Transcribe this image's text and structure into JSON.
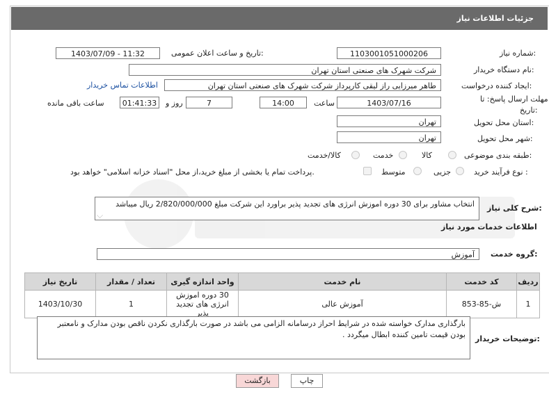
{
  "header": {
    "title": "جزئیات اطلاعات نیاز"
  },
  "fields": {
    "need_number_label": "شماره نیاز:",
    "need_number_value": "1103001051000206",
    "announce_label": "تاریخ و ساعت اعلان عمومی:",
    "announce_value": "1403/07/09 - 11:32",
    "buyer_org_label": "نام دستگاه خریدار:",
    "buyer_org_value": "شرکت شهرک های صنعتی استان تهران",
    "creator_label": "ایجاد کننده درخواست:",
    "creator_value": "طاهر  میرزایی راز لیقی کارپرداز شرکت شهرک های صنعتی استان تهران",
    "contact_link": "اطلاعات تماس خریدار",
    "deadline_label_1": "مهلت ارسال پاسخ: تا",
    "deadline_label_2": "تاریخ:",
    "deadline_date": "1403/07/16",
    "time_label": "ساعت",
    "deadline_time": "14:00",
    "days_value": "7",
    "days_label": "روز و",
    "remaining_value": "01:41:33",
    "remaining_label": "ساعت باقی مانده",
    "province_label": "استان محل تحویل:",
    "province_value": "تهران",
    "city_label": "شهر محل تحویل:",
    "city_value": "تهران",
    "category_label": "طبقه بندی موضوعی:",
    "category_options": [
      "کالا",
      "خدمت",
      "کالا/خدمت"
    ],
    "process_label": "نوع فرآیند خرید :",
    "process_options": [
      "جزیی",
      "متوسط"
    ],
    "payment_text": "پرداخت تمام یا بخشی از مبلغ خرید،از محل \"اسناد خزانه اسلامی\" خواهد بود."
  },
  "description": {
    "label": "شرح کلی نیاز:",
    "value": "انتخاب مشاور برای 30 دوره اموزش انرژی های تجدید پذیر براورد این شرکت مبلغ 2/820/000/000 ریال میباشد"
  },
  "services": {
    "section_title": "اطلاعات خدمات مورد نیاز",
    "group_label": "گروه خدمت:",
    "group_value": "آموزش",
    "columns": [
      "ردیف",
      "کد خدمت",
      "نام خدمت",
      "واحد اندازه گیری",
      "تعداد / مقدار",
      "تاریخ نیاز"
    ],
    "rows": [
      {
        "row": "1",
        "code": "ش-85-853",
        "name": "آموزش عالی",
        "unit": "30 دوره اموزش انرژی های تجدید پذیر",
        "qty": "1",
        "date": "1403/10/30"
      }
    ]
  },
  "buyer_notes": {
    "label": "توضیحات خریدار:",
    "value": "بارگذاری مدارک خواسته شده  در  شرایط احراز  درسامانه الزامی می باشد در صورت بارگذاری نکردن ناقص بودن مدارک و نامعتبر بودن قیمت تامین کننده ابطال میگردد ."
  },
  "buttons": {
    "print": "چاپ",
    "back": "بازگشت"
  },
  "colors": {
    "header_bg": "#6a6a6a",
    "table_header_bg": "#d8d8d8",
    "link": "#1a4fa0",
    "back_button_bg": "#f8d7d7"
  }
}
